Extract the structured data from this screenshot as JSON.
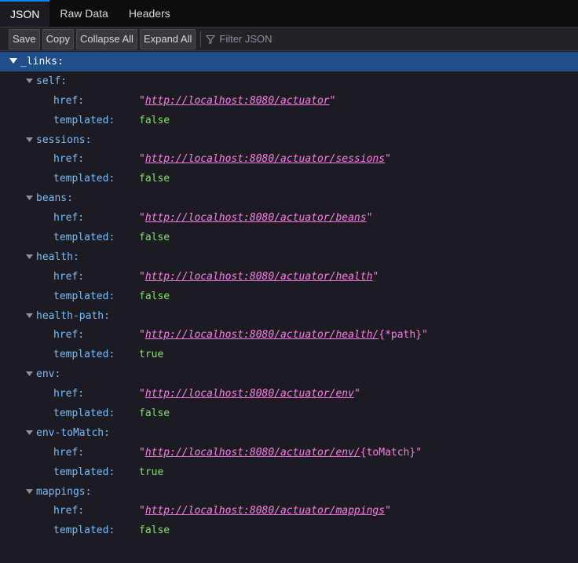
{
  "tabs": [
    {
      "label": "JSON"
    },
    {
      "label": "Raw Data"
    },
    {
      "label": "Headers"
    }
  ],
  "toolbar": {
    "save_label": "Save",
    "copy_label": "Copy",
    "collapse_label": "Collapse All",
    "expand_label": "Expand All",
    "filter_placeholder": "Filter JSON"
  },
  "colors": {
    "key": "#75bfff",
    "string": "#ff7de9",
    "boolean": "#86de74",
    "selected_row": "#204e8a",
    "accent": "#0a84ff"
  },
  "root": {
    "key": "_links:",
    "children": [
      {
        "key": "self:",
        "href_label": "href:",
        "href_url": "http://localhost:8080/actuator",
        "href_suffix": "",
        "templated_label": "templated:",
        "templated_value": "false"
      },
      {
        "key": "sessions:",
        "href_label": "href:",
        "href_url": "http://localhost:8080/actuator/sessions",
        "href_suffix": "",
        "templated_label": "templated:",
        "templated_value": "false"
      },
      {
        "key": "beans:",
        "href_label": "href:",
        "href_url": "http://localhost:8080/actuator/beans",
        "href_suffix": "",
        "templated_label": "templated:",
        "templated_value": "false"
      },
      {
        "key": "health:",
        "href_label": "href:",
        "href_url": "http://localhost:8080/actuator/health",
        "href_suffix": "",
        "templated_label": "templated:",
        "templated_value": "false"
      },
      {
        "key": "health-path:",
        "href_label": "href:",
        "href_url": "http://localhost:8080/actuator/health/",
        "href_suffix": "{*path}",
        "templated_label": "templated:",
        "templated_value": "true"
      },
      {
        "key": "env:",
        "href_label": "href:",
        "href_url": "http://localhost:8080/actuator/env",
        "href_suffix": "",
        "templated_label": "templated:",
        "templated_value": "false"
      },
      {
        "key": "env-toMatch:",
        "href_label": "href:",
        "href_url": "http://localhost:8080/actuator/env/",
        "href_suffix": "{toMatch}",
        "templated_label": "templated:",
        "templated_value": "true"
      },
      {
        "key": "mappings:",
        "href_label": "href:",
        "href_url": "http://localhost:8080/actuator/mappings",
        "href_suffix": "",
        "templated_label": "templated:",
        "templated_value": "false"
      }
    ]
  }
}
